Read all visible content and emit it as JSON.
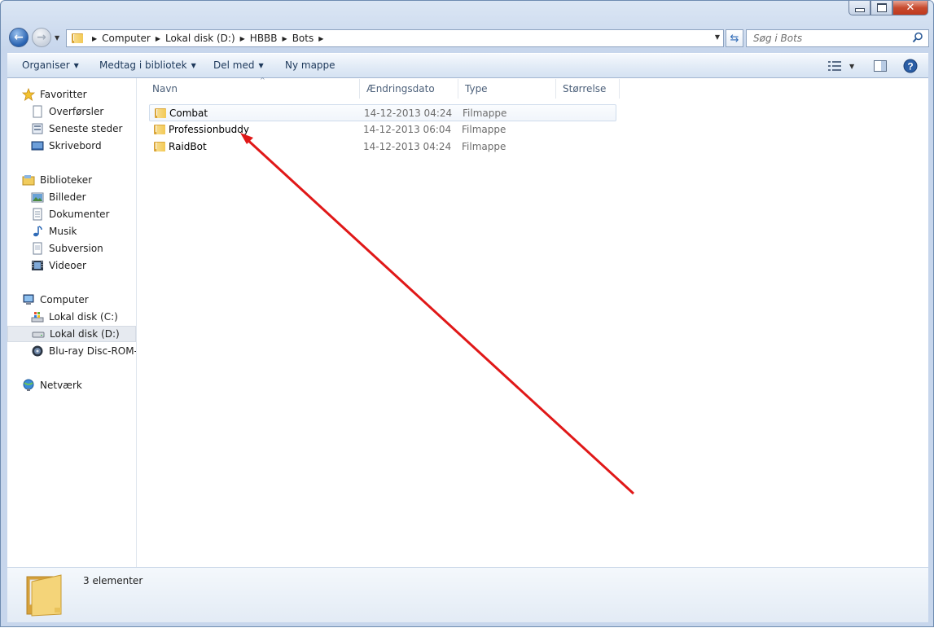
{
  "window": {
    "close_glyph": "✕"
  },
  "address": {
    "crumbs": [
      "Computer",
      "Lokal disk (D:)",
      "HBBB",
      "Bots"
    ],
    "search_placeholder": "Søg i Bots"
  },
  "toolbar": {
    "organise": "Organiser",
    "include_library": "Medtag i bibliotek",
    "share": "Del med",
    "new_folder": "Ny mappe"
  },
  "sidebar": {
    "favorites": {
      "label": "Favoritter",
      "items": [
        "Overførsler",
        "Seneste steder",
        "Skrivebord"
      ]
    },
    "libraries": {
      "label": "Biblioteker",
      "items": [
        "Billeder",
        "Dokumenter",
        "Musik",
        "Subversion",
        "Videoer"
      ]
    },
    "computer": {
      "label": "Computer",
      "items": [
        "Lokal disk (C:)",
        "Lokal disk (D:)",
        "Blu-ray Disc-ROM-d"
      ]
    },
    "network": {
      "label": "Netværk"
    }
  },
  "columns": {
    "name": "Navn",
    "date": "Ændringsdato",
    "type": "Type",
    "size": "Størrelse"
  },
  "files": [
    {
      "name": "Combat",
      "date": "14-12-2013 04:24",
      "type": "Filmappe"
    },
    {
      "name": "Professionbuddy",
      "date": "14-12-2013 06:04",
      "type": "Filmappe"
    },
    {
      "name": "RaidBot",
      "date": "14-12-2013 04:24",
      "type": "Filmappe"
    }
  ],
  "status": {
    "count": "3 elementer"
  },
  "annotation": {
    "color": "#e01818"
  }
}
